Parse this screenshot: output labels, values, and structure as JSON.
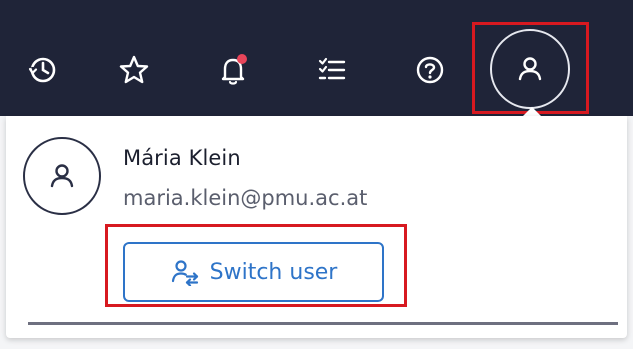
{
  "topbar": {
    "background": "#1f2438",
    "icons": [
      "history-icon",
      "star-icon",
      "bell-icon",
      "tasks-icon",
      "help-icon",
      "user-icon"
    ],
    "notification_dot_color": "#e8455a"
  },
  "account_menu": {
    "user_name": "Mária Klein",
    "user_email": "maria.klein@pmu.ac.at",
    "switch_user_label": "Switch user",
    "accent_color": "#2e74c8",
    "highlight_color": "#d71920"
  }
}
